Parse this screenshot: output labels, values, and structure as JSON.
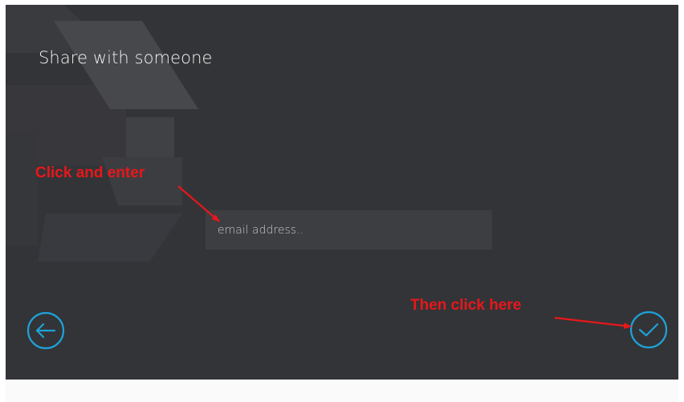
{
  "page": {
    "title": "Share with someone"
  },
  "email": {
    "placeholder": "email address..",
    "value": ""
  },
  "navigation": {
    "back_icon": "arrow-left-circle-icon",
    "confirm_icon": "checkmark-circle-icon"
  },
  "annotations": {
    "enter_hint": "Click and enter",
    "click_hint": "Then click here"
  },
  "colors": {
    "background": "#333437",
    "accent": "#1ea2d8",
    "annotation": "#e8171b",
    "field": "#3d3e41"
  }
}
